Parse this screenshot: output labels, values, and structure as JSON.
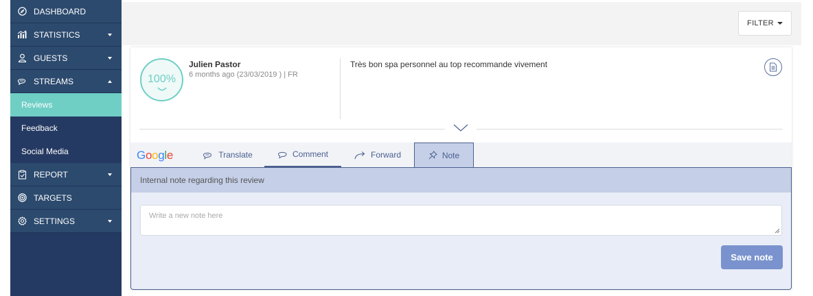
{
  "sidebar": {
    "items": [
      {
        "label": "DASHBOARD",
        "icon": "compass-icon"
      },
      {
        "label": "STATISTICS",
        "icon": "bar-chart-icon"
      },
      {
        "label": "GUESTS",
        "icon": "user-icon"
      },
      {
        "label": "STREAMS",
        "icon": "chat-bubbles-icon"
      },
      {
        "label": "REPORT",
        "icon": "clipboard-icon"
      },
      {
        "label": "TARGETS",
        "icon": "target-icon"
      },
      {
        "label": "SETTINGS",
        "icon": "gear-icon"
      }
    ],
    "stream_subitems": [
      {
        "label": "Reviews",
        "active": true
      },
      {
        "label": "Feedback"
      },
      {
        "label": "Social Media"
      }
    ]
  },
  "toolbar": {
    "filter_label": "FILTER"
  },
  "review": {
    "score": "100%",
    "author": "Julien Pastor",
    "meta": "6 months ago (23/03/2019 ) | FR",
    "text": "Très bon spa personnel au top recommande vivement",
    "source": "Google"
  },
  "tabs": {
    "translate": "Translate",
    "comment": "Comment",
    "forward": "Forward",
    "note": "Note"
  },
  "note": {
    "header": "Internal note regarding this review",
    "placeholder": "Write a new note here",
    "save_label": "Save note"
  },
  "colors": {
    "sidebar_bg": "#253a62",
    "sidebar_item_bg": "#2c4a6e",
    "active_teal": "#6fcfc5",
    "accent_blue": "#4a5f8e",
    "save_button": "#7a93ce",
    "note_header_bg": "#c5cfe7"
  }
}
